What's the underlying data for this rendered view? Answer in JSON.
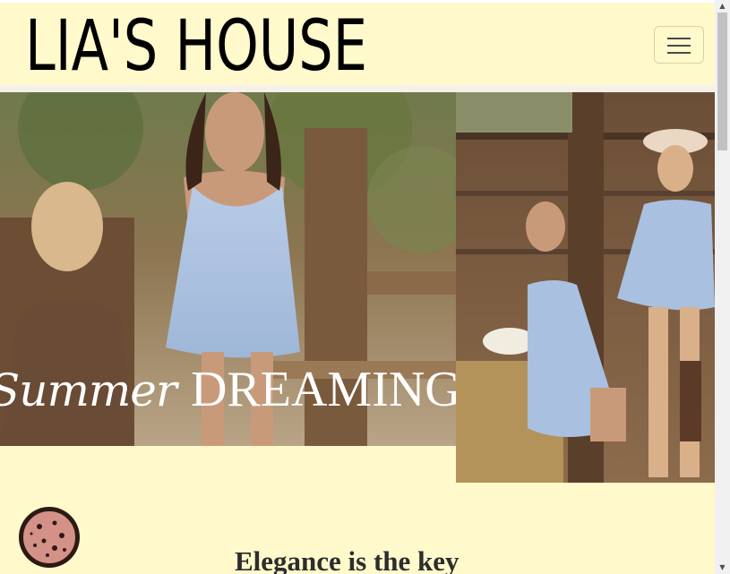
{
  "site": {
    "brand_name": "Lia's House",
    "brand_text": "LIA'S HOUSE"
  },
  "navbar": {
    "toggle_icon": "hamburger-icon"
  },
  "hero": {
    "left_caption_script": "Summer",
    "left_caption_caps": "DREAMING"
  },
  "main": {
    "section_title": "Elegance is the key"
  },
  "cookie": {
    "icon": "cookie-icon"
  },
  "colors": {
    "background": "#fff9cc",
    "text": "#000000"
  }
}
